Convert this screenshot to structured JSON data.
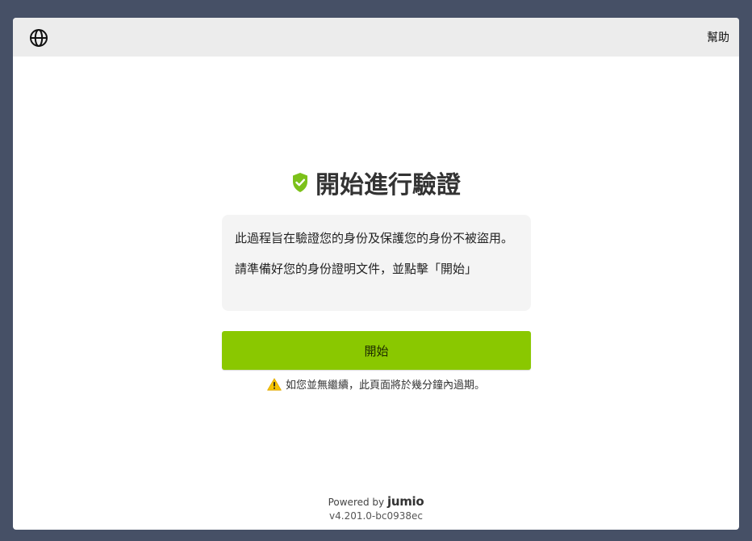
{
  "header": {
    "language_icon": "globe-icon",
    "help_label": "幫助"
  },
  "main": {
    "title_icon": "shield-check-icon",
    "title": "開始進行驗證",
    "info_paragraph_1": "此過程旨在驗證您的身份及保護您的身份不被盜用。",
    "info_paragraph_2": "請準備好您的身份證明文件，並點擊「開始」",
    "start_button_label": "開始",
    "warning_icon": "warning-icon",
    "warning_text": "如您並無繼續，此頁面將於幾分鐘內過期。"
  },
  "footer": {
    "powered_by": "Powered by",
    "brand": "jumio",
    "version": "v4.201.0-bc0938ec"
  },
  "colors": {
    "background": "#465066",
    "card": "#ffffff",
    "topbar": "#ececec",
    "accent": "#8ac800",
    "shield": "#7cc11a",
    "warning": "#f5c400"
  }
}
